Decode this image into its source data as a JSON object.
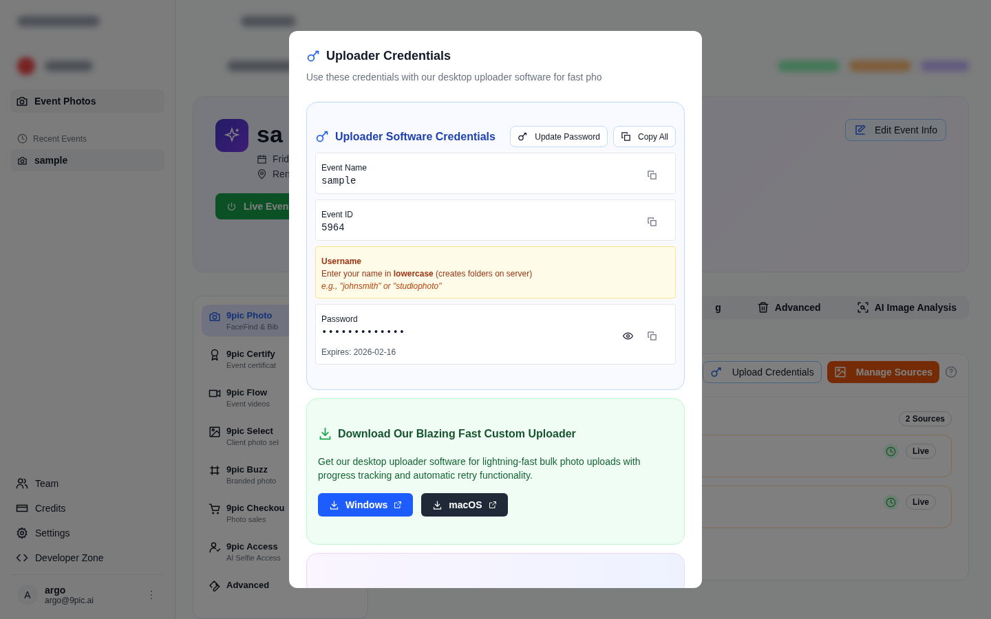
{
  "sidebar": {
    "section": "Event Photos",
    "recent_label": "Recent Events",
    "recent_events": [
      {
        "label": "sample",
        "selected": true
      }
    ],
    "nav": [
      {
        "label": "Team"
      },
      {
        "label": "Credits"
      },
      {
        "label": "Settings"
      },
      {
        "label": "Developer Zone"
      }
    ],
    "user": {
      "initial": "A",
      "name": "argo",
      "email": "argo@9pic.ai"
    }
  },
  "event": {
    "title": "sa",
    "date": "Frid",
    "location": "Ren",
    "live_button": "Live Even",
    "edit_button": "Edit Event Info"
  },
  "modules": [
    {
      "name": "9pic Photo",
      "desc": "FaceFind & Bib",
      "selected": true
    },
    {
      "name": "9pic Certify",
      "desc": "Event certificat",
      "selected": false
    },
    {
      "name": "9pic Flow",
      "desc": "Event videos",
      "selected": false
    },
    {
      "name": "9pic Select",
      "desc": "Client photo sel",
      "selected": false
    },
    {
      "name": "9pic Buzz",
      "desc": "Branded photo",
      "selected": false
    },
    {
      "name": "9pic Checkou",
      "desc": "Photo sales",
      "selected": false
    },
    {
      "name": "9pic Access",
      "desc": "AI Selfie Access",
      "selected": false
    },
    {
      "name": "Advanced",
      "selected": false
    }
  ],
  "tabs": [
    {
      "label": "g"
    },
    {
      "label": "Advanced"
    },
    {
      "label": "AI Image Analysis"
    }
  ],
  "sources_toolbar": {
    "credentials_button": "Upload Credentials",
    "manage_button": "Manage Sources"
  },
  "sources": {
    "count": "2 Sources",
    "rows": [
      {
        "status": "Live"
      },
      {
        "status": "Live"
      }
    ]
  },
  "modal": {
    "title": "Uploader Credentials",
    "subtitle": "Use these credentials with our desktop uploader software for fast pho",
    "card_title": "Uploader Software Credentials",
    "update_button": "Update Password",
    "copy_all_button": "Copy All",
    "fields": [
      {
        "kind": "plain",
        "label": "Event Name",
        "value": "sample"
      },
      {
        "kind": "plain",
        "label": "Event ID",
        "value": "5964"
      },
      {
        "kind": "notice",
        "label": "Username",
        "text": "Enter your name in **lowercase** (creates folders on server)",
        "example": "e.g., \"johnsmith\" or \"studiophoto\""
      },
      {
        "kind": "secret",
        "label": "Password",
        "value": "•••••••••••••",
        "expires": "Expires: 2026-02-16"
      }
    ],
    "download": {
      "title": "Download Our Blazing Fast Custom Uploader",
      "text": "Get our desktop uploader software for lightning-fast bulk photo uploads with progress tracking and automatic retry functionality.",
      "buttons": [
        {
          "label": "Windows",
          "kind": "primary"
        },
        {
          "label": "macOS",
          "kind": "dark"
        }
      ]
    }
  }
}
